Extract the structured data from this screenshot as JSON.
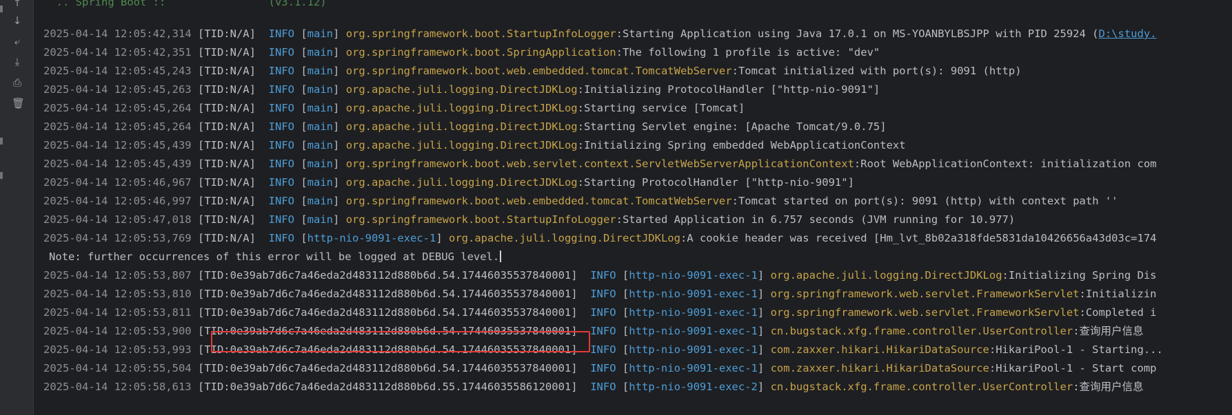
{
  "gutter": {
    "icons": [
      "arrow-up-icon",
      "arrow-down-icon",
      "soft-wrap-icon",
      "scroll-to-end-icon",
      "print-icon",
      "trash-icon"
    ]
  },
  "console": {
    "top_fragment": "  .. Spring Boot ::                (v3.1.12)",
    "lines": [
      {
        "ts": "2025-04-14 12:05:42,314",
        "tid": "[TID:N/A]",
        "lvl": "  INFO",
        "thread": "main",
        "logger": "org.springframework.boot.StartupInfoLogger",
        "msg": ":Starting Application using Java 17.0.1 on MS-YOANBYLBSJPP with PID 25924 (",
        "link": "D:\\study.",
        "tail": ""
      },
      {
        "ts": "2025-04-14 12:05:42,351",
        "tid": "[TID:N/A]",
        "lvl": "  INFO",
        "thread": "main",
        "logger": "org.springframework.boot.SpringApplication",
        "msg": ":The following 1 profile is active: \"dev\"",
        "link": "",
        "tail": ""
      },
      {
        "ts": "2025-04-14 12:05:45,243",
        "tid": "[TID:N/A]",
        "lvl": "  INFO",
        "thread": "main",
        "logger": "org.springframework.boot.web.embedded.tomcat.TomcatWebServer",
        "msg": ":Tomcat initialized with port(s): 9091 (http)",
        "link": "",
        "tail": ""
      },
      {
        "ts": "2025-04-14 12:05:45,263",
        "tid": "[TID:N/A]",
        "lvl": "  INFO",
        "thread": "main",
        "logger": "org.apache.juli.logging.DirectJDKLog",
        "msg": ":Initializing ProtocolHandler [\"http-nio-9091\"]",
        "link": "",
        "tail": ""
      },
      {
        "ts": "2025-04-14 12:05:45,264",
        "tid": "[TID:N/A]",
        "lvl": "  INFO",
        "thread": "main",
        "logger": "org.apache.juli.logging.DirectJDKLog",
        "msg": ":Starting service [Tomcat]",
        "link": "",
        "tail": ""
      },
      {
        "ts": "2025-04-14 12:05:45,264",
        "tid": "[TID:N/A]",
        "lvl": "  INFO",
        "thread": "main",
        "logger": "org.apache.juli.logging.DirectJDKLog",
        "msg": ":Starting Servlet engine: [Apache Tomcat/9.0.75]",
        "link": "",
        "tail": ""
      },
      {
        "ts": "2025-04-14 12:05:45,439",
        "tid": "[TID:N/A]",
        "lvl": "  INFO",
        "thread": "main",
        "logger": "org.apache.juli.logging.DirectJDKLog",
        "msg": ":Initializing Spring embedded WebApplicationContext",
        "link": "",
        "tail": ""
      },
      {
        "ts": "2025-04-14 12:05:45,439",
        "tid": "[TID:N/A]",
        "lvl": "  INFO",
        "thread": "main",
        "logger": "org.springframework.boot.web.servlet.context.ServletWebServerApplicationContext",
        "msg": ":Root WebApplicationContext: initialization com",
        "link": "",
        "tail": ""
      },
      {
        "ts": "2025-04-14 12:05:46,967",
        "tid": "[TID:N/A]",
        "lvl": "  INFO",
        "thread": "main",
        "logger": "org.apache.juli.logging.DirectJDKLog",
        "msg": ":Starting ProtocolHandler [\"http-nio-9091\"]",
        "link": "",
        "tail": ""
      },
      {
        "ts": "2025-04-14 12:05:46,997",
        "tid": "[TID:N/A]",
        "lvl": "  INFO",
        "thread": "main",
        "logger": "org.springframework.boot.web.embedded.tomcat.TomcatWebServer",
        "msg": ":Tomcat started on port(s): 9091 (http) with context path ''",
        "link": "",
        "tail": ""
      },
      {
        "ts": "2025-04-14 12:05:47,018",
        "tid": "[TID:N/A]",
        "lvl": "  INFO",
        "thread": "main",
        "logger": "org.springframework.boot.StartupInfoLogger",
        "msg": ":Started Application in 6.757 seconds (JVM running for 10.977)",
        "link": "",
        "tail": ""
      },
      {
        "ts": "2025-04-14 12:05:53,769",
        "tid": "[TID:N/A]",
        "lvl": "  INFO",
        "thread": "http-nio-9091-exec-1",
        "logger": "org.apache.juli.logging.DirectJDKLog",
        "msg": ":A cookie header was received [Hm_lvt_8b02a318fde5831da10426656a43d03c=174",
        "link": "",
        "tail": ""
      },
      {
        "note": "Note: further occurrences of this error will be logged at DEBUG level."
      },
      {
        "ts": "2025-04-14 12:05:53,807",
        "tid": "[TID:0e39ab7d6c7a46eda2d483112d880b6d.54.17446035537840001]",
        "lvl": "  INFO",
        "thread": "http-nio-9091-exec-1",
        "logger": "org.apache.juli.logging.DirectJDKLog",
        "msg": ":Initializing Spring Dis",
        "link": "",
        "tail": ""
      },
      {
        "ts": "2025-04-14 12:05:53,810",
        "tid": "[TID:0e39ab7d6c7a46eda2d483112d880b6d.54.17446035537840001]",
        "lvl": "  INFO",
        "thread": "http-nio-9091-exec-1",
        "logger": "org.springframework.web.servlet.FrameworkServlet",
        "msg": ":Initializin",
        "link": "",
        "tail": ""
      },
      {
        "ts": "2025-04-14 12:05:53,811",
        "tid": "[TID:0e39ab7d6c7a46eda2d483112d880b6d.54.17446035537840001]",
        "lvl": "  INFO",
        "thread": "http-nio-9091-exec-1",
        "logger": "org.springframework.web.servlet.FrameworkServlet",
        "msg": ":Completed i",
        "link": "",
        "tail": ""
      },
      {
        "ts": "2025-04-14 12:05:53,900",
        "tid": "[TID:0e39ab7d6c7a46eda2d483112d880b6d.54.17446035537840001]",
        "lvl": "  INFO",
        "thread": "http-nio-9091-exec-1",
        "logger": "cn.bugstack.xfg.frame.controller.UserController",
        "msg": ":查询用户信息",
        "link": "",
        "tail": ""
      },
      {
        "ts": "2025-04-14 12:05:53,993",
        "tid": "[TID:0e39ab7d6c7a46eda2d483112d880b6d.54.17446035537840001]",
        "lvl": "  INFO",
        "thread": "http-nio-9091-exec-1",
        "logger": "com.zaxxer.hikari.HikariDataSource",
        "msg": ":HikariPool-1 - Starting...",
        "link": "",
        "tail": ""
      },
      {
        "ts": "2025-04-14 12:05:55,504",
        "tid": "[TID:0e39ab7d6c7a46eda2d483112d880b6d.54.17446035537840001]",
        "lvl": "  INFO",
        "thread": "http-nio-9091-exec-1",
        "logger": "com.zaxxer.hikari.HikariDataSource",
        "msg": ":HikariPool-1 - Start comp",
        "link": "",
        "tail": ""
      },
      {
        "ts": "2025-04-14 12:05:58,613",
        "tid": "[TID:0e39ab7d6c7a46eda2d483112d880b6d.55.17446035586120001]",
        "lvl": "  INFO",
        "thread": "http-nio-9091-exec-2",
        "logger": "cn.bugstack.xfg.frame.controller.UserController",
        "msg": ":查询用户信息",
        "link": "",
        "tail": "",
        "highlight": true
      }
    ]
  },
  "colors": {
    "background": "#1e1f22",
    "gutter": "#2b2d30",
    "timestamp": "#8c8f96",
    "info": "#4d9ed8",
    "thread": "#4d9ed8",
    "logger": "#c7a44a",
    "text": "#bcbec4",
    "highlight_box": "#e53935"
  }
}
